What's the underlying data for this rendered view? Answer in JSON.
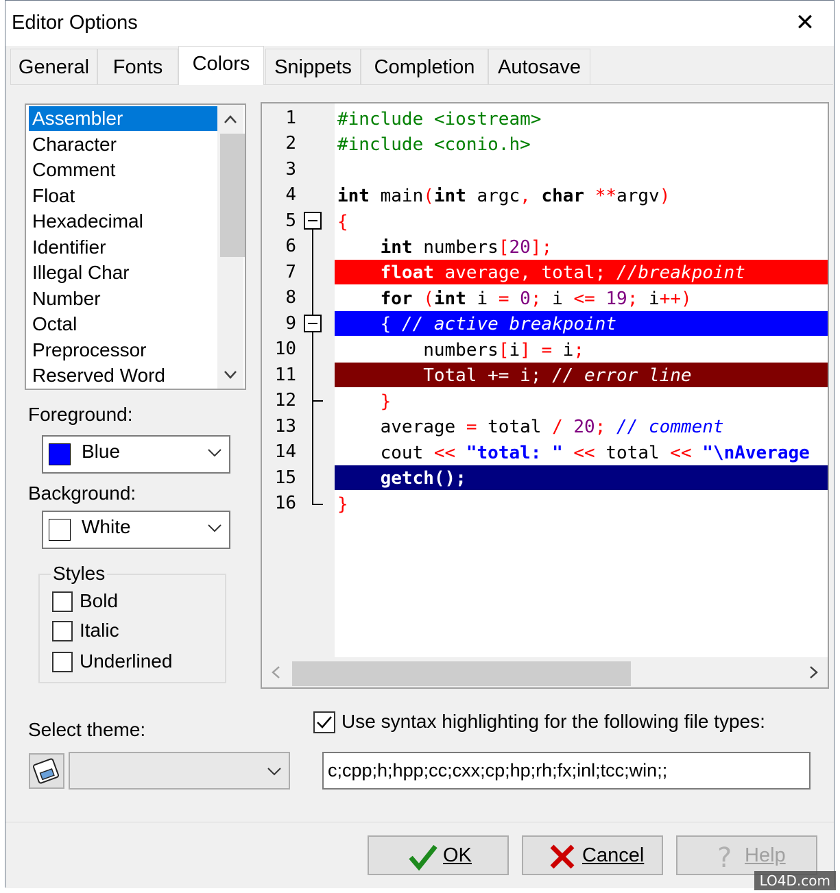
{
  "window": {
    "title": "Editor Options",
    "close_glyph": "✕"
  },
  "tabs": [
    {
      "label": "General"
    },
    {
      "label": "Fonts"
    },
    {
      "label": "Colors"
    },
    {
      "label": "Snippets"
    },
    {
      "label": "Completion"
    },
    {
      "label": "Autosave"
    }
  ],
  "active_tab": "Colors",
  "element_list": {
    "items": [
      "Assembler",
      "Character",
      "Comment",
      "Float",
      "Hexadecimal",
      "Identifier",
      "Illegal Char",
      "Number",
      "Octal",
      "Preprocessor",
      "Reserved Word"
    ],
    "selected": "Assembler"
  },
  "foreground": {
    "label": "Foreground:",
    "value": "Blue",
    "color": "#0000ff"
  },
  "background": {
    "label": "Background:",
    "value": "White",
    "color": "#ffffff"
  },
  "styles": {
    "title": "Styles",
    "bold": {
      "label": "Bold",
      "checked": false
    },
    "italic": {
      "label": "Italic",
      "checked": false
    },
    "underlined": {
      "label": "Underlined",
      "checked": false
    }
  },
  "editor": {
    "line_numbers": [
      "1",
      "2",
      "3",
      "4",
      "5",
      "6",
      "7",
      "8",
      "9",
      "10",
      "11",
      "12",
      "13",
      "14",
      "15",
      "16"
    ],
    "highlight_colors": {
      "breakpoint": "#ff0000",
      "active_breakpoint": "#0000ff",
      "error_line": "#800000",
      "exec_line": "#000080"
    }
  },
  "theme": {
    "label": "Select theme:",
    "value": ""
  },
  "syntax": {
    "checkbox_label": "Use syntax highlighting for the following file types:",
    "checked": true,
    "file_types": "c;cpp;h;hpp;cc;cxx;cp;hp;rh;fx;inl;tcc;win;;"
  },
  "buttons": {
    "ok": "OK",
    "cancel": "Cancel",
    "help": "Help"
  },
  "watermark": "LO4D.com"
}
